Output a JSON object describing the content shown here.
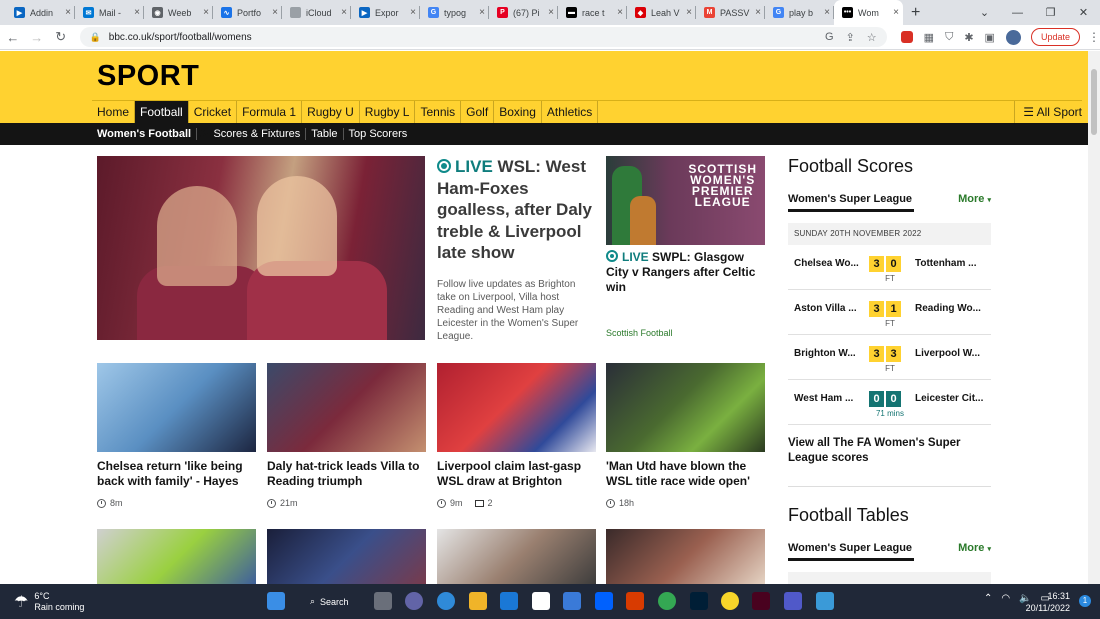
{
  "browser": {
    "tabs": [
      {
        "label": "Addin",
        "fav_color": "#0a66c2",
        "fav_glyph": "▶"
      },
      {
        "label": "Mail -",
        "fav_color": "#0078d4",
        "fav_glyph": "✉"
      },
      {
        "label": "Weeb",
        "fav_color": "#5f6368",
        "fav_glyph": "◉"
      },
      {
        "label": "Portfo",
        "fav_color": "#1a73e8",
        "fav_glyph": "∿"
      },
      {
        "label": "iCloud",
        "fav_color": "#9aa0a6",
        "fav_glyph": ""
      },
      {
        "label": "Expor",
        "fav_color": "#0a66c2",
        "fav_glyph": "▶"
      },
      {
        "label": "typog",
        "fav_color": "#4285f4",
        "fav_glyph": "G"
      },
      {
        "label": "(67) Pi",
        "fav_color": "#e60023",
        "fav_glyph": "P"
      },
      {
        "label": "race t",
        "fav_color": "#000000",
        "fav_glyph": "▬"
      },
      {
        "label": "Leah V",
        "fav_color": "#db0007",
        "fav_glyph": "◆"
      },
      {
        "label": "PASSV",
        "fav_color": "#ea4335",
        "fav_glyph": "M"
      },
      {
        "label": "play b",
        "fav_color": "#4285f4",
        "fav_glyph": "G"
      },
      {
        "label": "Wom",
        "fav_color": "#000000",
        "fav_glyph": "•••",
        "active": true
      }
    ],
    "url": "bbc.co.uk/sport/football/womens",
    "update_label": "Update"
  },
  "header": {
    "title": "SPORT",
    "nav": [
      "Home",
      "Football",
      "Cricket",
      "Formula 1",
      "Rugby U",
      "Rugby L",
      "Tennis",
      "Golf",
      "Boxing",
      "Athletics"
    ],
    "active_nav": "Football",
    "all_sport": "All Sport",
    "subnav": [
      "Women's Football",
      "Scores & Fixtures",
      "Table",
      "Top Scorers"
    ]
  },
  "lead": {
    "live": "LIVE",
    "headline": "WSL: West Ham-Foxes goalless, after Daly treble & Liverpool late show",
    "summary": "Follow live updates as Brighton take on Liverpool, Villa host Reading and West Ham play Leicester in the Women's Super League."
  },
  "promo": {
    "logo_lines": [
      "SCOTTISH",
      "WOMEN'S",
      "PREMIER",
      "LEAGUE"
    ],
    "live": "LIVE",
    "headline": "SWPL: Glasgow City v Rangers after Celtic win",
    "tag": "Scottish Football"
  },
  "cards": [
    {
      "headline": "Chelsea return 'like being back with family' - Hayes",
      "time": "8m"
    },
    {
      "headline": "Daly hat-trick leads Villa to Reading triumph",
      "time": "21m"
    },
    {
      "headline": "Liverpool claim last-gasp WSL draw at Brighton",
      "time": "9m",
      "comments": "2"
    },
    {
      "headline": "'Man Utd have blown the WSL title race wide open'",
      "time": "18h"
    }
  ],
  "scores": {
    "title": "Football Scores",
    "competition": "Women's Super League",
    "more": "More",
    "date": "SUNDAY 20TH NOVEMBER 2022",
    "matches": [
      {
        "home": "Chelsea Wo...",
        "hs": "3",
        "as": "0",
        "away": "Tottenham ...",
        "status": "FT",
        "live": false
      },
      {
        "home": "Aston Villa ...",
        "hs": "3",
        "as": "1",
        "away": "Reading Wo...",
        "status": "FT",
        "live": false
      },
      {
        "home": "Brighton W...",
        "hs": "3",
        "as": "3",
        "away": "Liverpool W...",
        "status": "FT",
        "live": false
      },
      {
        "home": "West Ham ...",
        "hs": "0",
        "as": "0",
        "away": "Leicester Cit...",
        "status": "71 mins",
        "live": true
      }
    ],
    "view_all": "View all The FA Women's Super League scores"
  },
  "tables": {
    "title": "Football Tables",
    "competition": "Women's Super League",
    "more": "More"
  },
  "taskbar": {
    "temp": "6°C",
    "weather": "Rain coming",
    "search": "Search",
    "time": "16:31",
    "date": "20/11/2022",
    "notifications": "1"
  }
}
